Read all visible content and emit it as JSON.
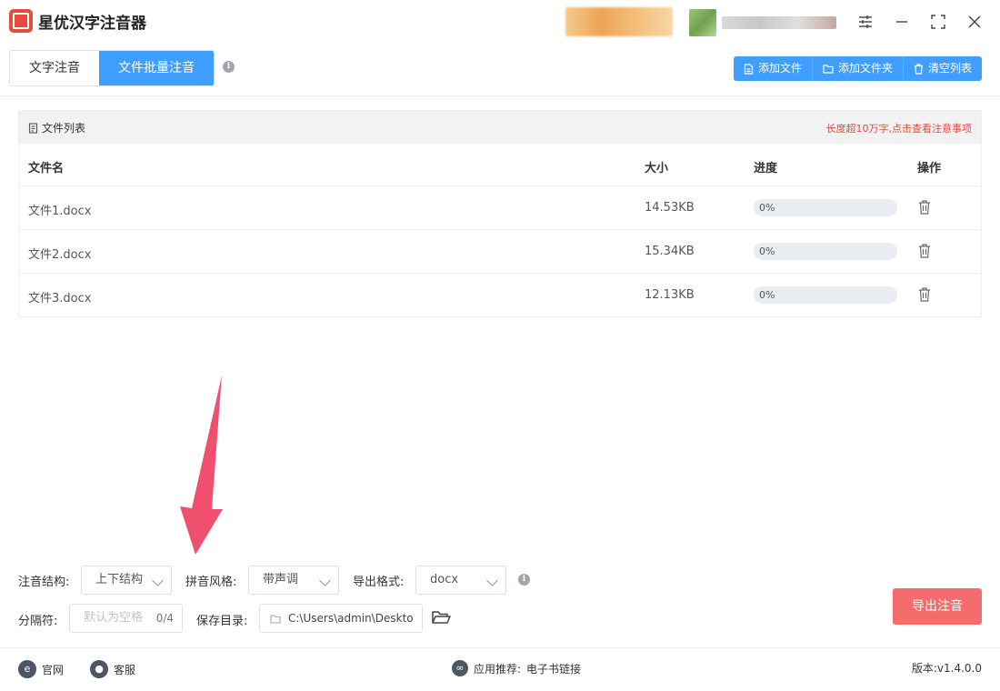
{
  "app": {
    "title": "星优汉字注音器"
  },
  "tabs": [
    {
      "label": "文字注音"
    },
    {
      "label": "文件批量注音"
    }
  ],
  "toolbar": {
    "add_file": "添加文件",
    "add_folder": "添加文件夹",
    "clear_list": "清空列表"
  },
  "panel": {
    "title": "文件列表",
    "notice": "长度超10万字,点击查看注意事项"
  },
  "table": {
    "columns": [
      "文件名",
      "大小",
      "进度",
      "操作"
    ],
    "rows": [
      {
        "name": "文件1.docx",
        "size": "14.53KB",
        "progress": "0%"
      },
      {
        "name": "文件2.docx",
        "size": "15.34KB",
        "progress": "0%"
      },
      {
        "name": "文件3.docx",
        "size": "12.13KB",
        "progress": "0%"
      }
    ]
  },
  "options": {
    "structure_label": "注音结构:",
    "structure_value": "上下结构",
    "style_label": "拼音风格:",
    "style_value": "带声调",
    "format_label": "导出格式:",
    "format_value": "docx",
    "separator_label": "分隔符:",
    "separator_placeholder": "默认为空格",
    "separator_count": "0/4",
    "save_label": "保存目录:",
    "save_value": "C:\\Users\\admin\\Deskto"
  },
  "export_button": "导出注音",
  "footer": {
    "website": "官网",
    "support": "客服",
    "recommend_label": "应用推荐:",
    "recommend_link": "电子书链接",
    "version": "版本:v1.4.0.0"
  },
  "colors": {
    "primary": "#409eff",
    "danger": "#f56c6c",
    "notice": "#e84a3d",
    "logo": "#e84a3d"
  }
}
